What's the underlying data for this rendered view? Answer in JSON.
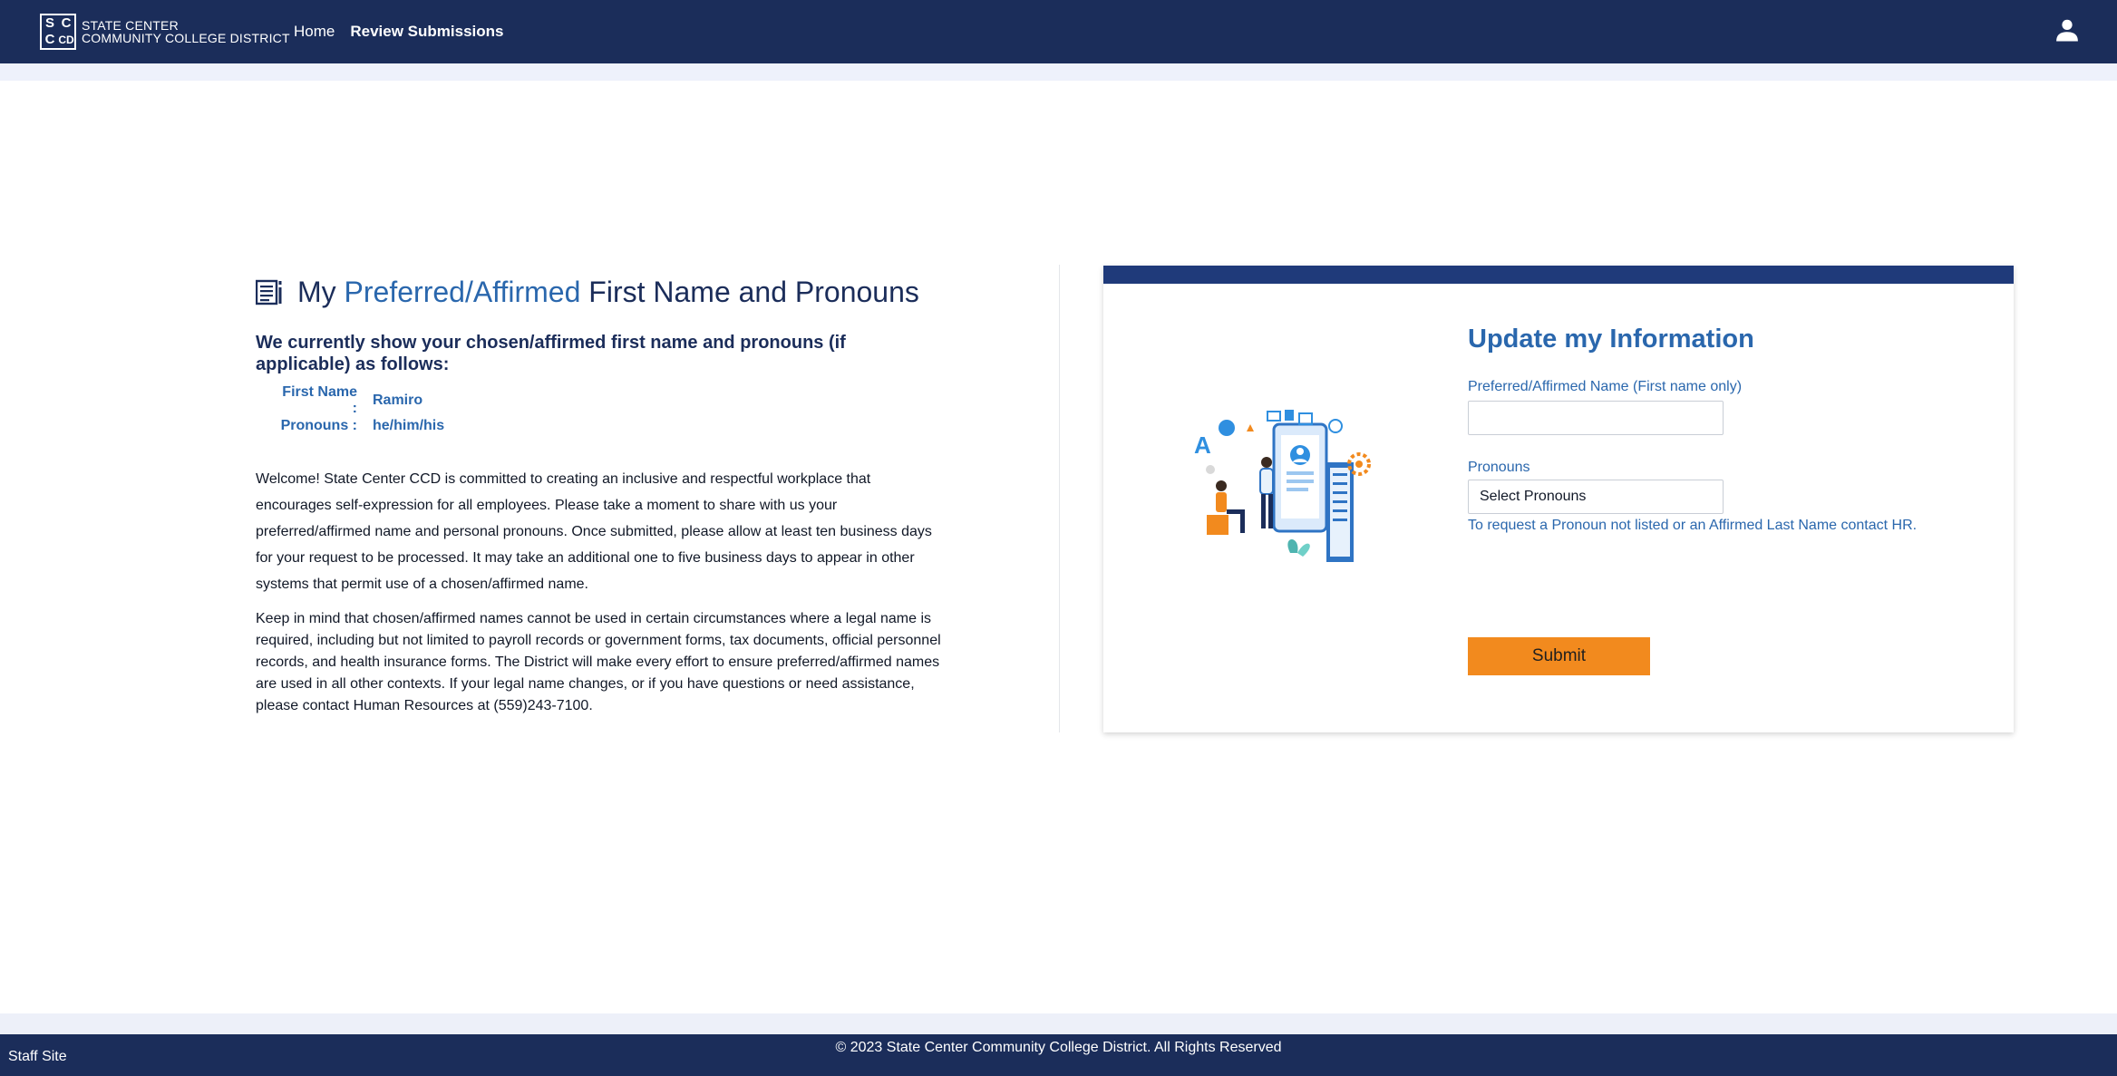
{
  "header": {
    "logo": {
      "mark": [
        "S",
        "C",
        "C",
        "CD"
      ],
      "line1": "STATE CENTER",
      "line2": "COMMUNITY COLLEGE DISTRICT"
    },
    "nav": [
      {
        "label": "Home"
      },
      {
        "label": "Review Submissions"
      }
    ],
    "user_icon": "user-icon"
  },
  "main": {
    "title_prefix": "My ",
    "title_highlight": "Preferred/Affirmed",
    "title_suffix": " First Name and Pronouns",
    "current_heading": "We currently show your chosen/affirmed first name and pronouns (if applicable) as follows:",
    "first_name_label": "First Name :",
    "first_name_value": "Ramiro",
    "pronouns_label": "Pronouns :",
    "pronouns_value": "he/him/his",
    "paragraph1": "Welcome! State Center CCD is committed to creating an inclusive and respectful workplace that encourages self-expression for all employees. Please take a moment to share with us your preferred/affirmed name and personal pronouns. Once submitted, please allow at least ten business days for your request to be processed. It may take an additional one to five business days to appear in other systems that permit use of a chosen/affirmed name.",
    "paragraph2": "Keep in mind that chosen/affirmed names cannot be used in certain circumstances where a legal name is required, including but not limited to payroll records or government forms, tax documents, official personnel records, and health insurance forms. The District will make every effort to ensure preferred/affirmed names are used in all other contexts. If your legal name changes, or if you have questions or need assistance, please contact Human Resources at (559)243-7100."
  },
  "form": {
    "title": "Update my Information",
    "name_label": "Preferred/Affirmed Name (First name only)",
    "name_value": "",
    "pronouns_label": "Pronouns",
    "pronouns_selected": "Select Pronouns",
    "hr_note": "To request a Pronoun not listed or an Affirmed Last Name contact HR.",
    "submit_label": "Submit"
  },
  "footer": {
    "staff_site": "Staff Site",
    "copyright": "© 2023 State Center Community College District. All Rights Reserved"
  },
  "colors": {
    "navy": "#1b2d5a",
    "accent_blue": "#2a67ad",
    "submit_orange": "#f28a1e"
  }
}
